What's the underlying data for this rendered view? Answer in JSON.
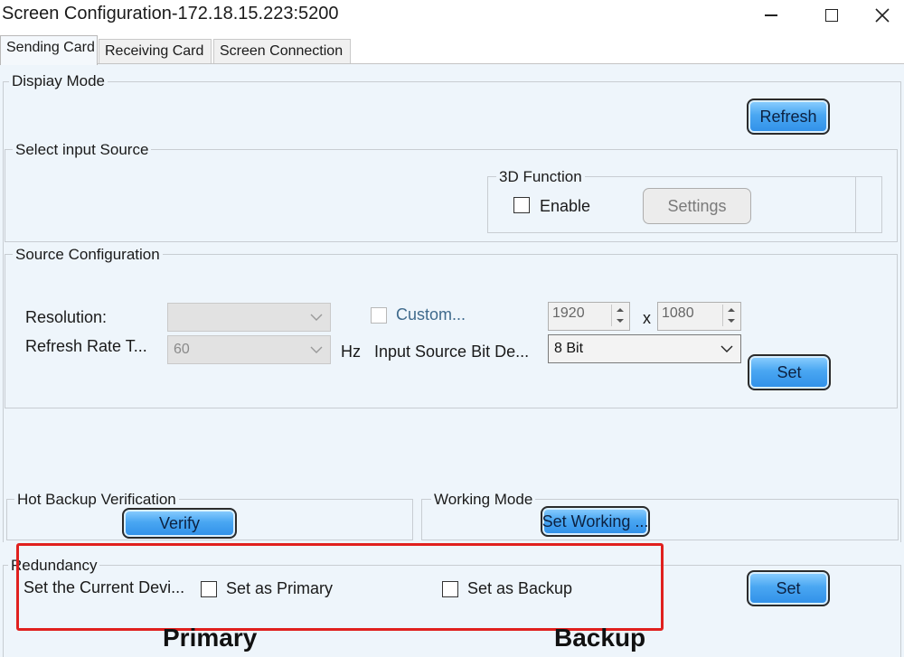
{
  "window": {
    "title": "Screen Configuration-172.18.15.223:5200"
  },
  "tabs": [
    {
      "label": "Sending Card"
    },
    {
      "label": "Receiving Card"
    },
    {
      "label": "Screen Connection"
    }
  ],
  "display_mode": {
    "group_label": "Dispiay Mode",
    "refresh_label": "Refresh"
  },
  "input_source": {
    "group_label": "Select input Source",
    "function_3d": {
      "group_label": "3D Function",
      "enable_label": "Enable",
      "settings_label": "Settings"
    }
  },
  "source_config": {
    "group_label": "Source Configuration",
    "resolution_label": "Resolution:",
    "resolution_value": "",
    "custom_label": "Custom...",
    "width_value": "1920",
    "x_label": "x",
    "height_value": "1080",
    "refresh_rate_label": "Refresh Rate T...",
    "refresh_rate_value": "60",
    "hz_label": "Hz",
    "bit_depth_label": "Input Source Bit De...",
    "bit_depth_value": "8 Bit",
    "set_label": "Set"
  },
  "hot_backup": {
    "group_label": "Hot Backup Verification",
    "verify_label": "Verify"
  },
  "working_mode": {
    "group_label": "Working Mode",
    "button_label": "Set Working ..."
  },
  "redundancy": {
    "group_label": "Redundancy",
    "current_device_label": "Set the Current Devi...",
    "primary_label": "Set as Primary",
    "backup_label": "Set as Backup",
    "set_label": "Set"
  },
  "annotations": {
    "primary_text": "Primary",
    "backup_text": "Backup"
  },
  "colors": {
    "highlight": "#e0201e",
    "button_blue": "#4aa7f2",
    "panel_bg": "#eef5fb"
  }
}
